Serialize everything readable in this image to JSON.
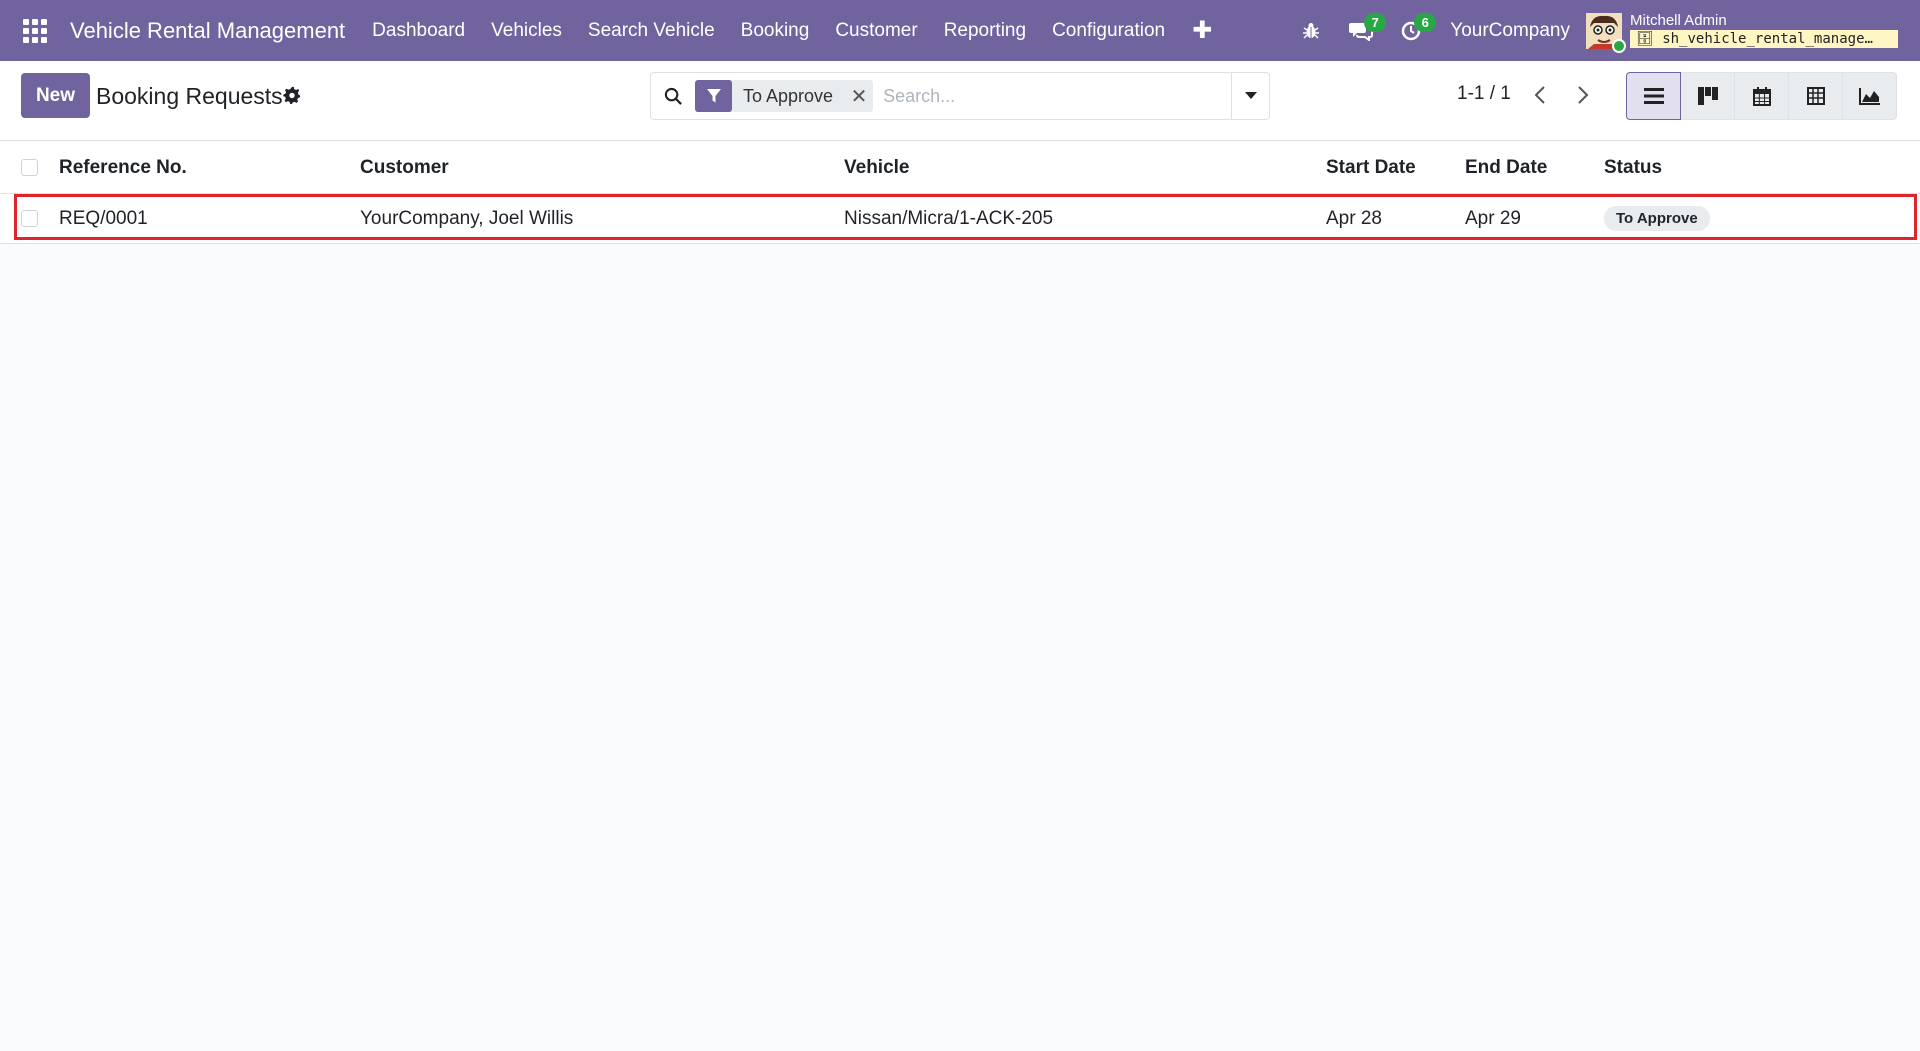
{
  "navbar": {
    "brand": "Vehicle Rental Management",
    "menu": [
      "Dashboard",
      "Vehicles",
      "Search Vehicle",
      "Booking",
      "Customer",
      "Reporting",
      "Configuration"
    ],
    "messages_count": "7",
    "activities_count": "6",
    "company": "YourCompany",
    "user_name": "Mitchell Admin",
    "database": "sh_vehicle_rental_manage…"
  },
  "control_panel": {
    "new_label": "New",
    "title": "Booking Requests",
    "facet_label": "To Approve",
    "search_placeholder": "Search...",
    "pager": "1-1 / 1"
  },
  "list": {
    "columns": [
      "Reference No.",
      "Customer",
      "Vehicle",
      "Start Date",
      "End Date",
      "Status"
    ],
    "rows": [
      {
        "reference": "REQ/0001",
        "customer": "YourCompany, Joel Willis",
        "vehicle": "Nissan/Micra/1-ACK-205",
        "start_date": "Apr 28",
        "end_date": "Apr 29",
        "status": "To Approve"
      }
    ]
  },
  "colors": {
    "brand": "#71639e",
    "badge_green": "#28a745",
    "highlight": "#e0242b"
  }
}
